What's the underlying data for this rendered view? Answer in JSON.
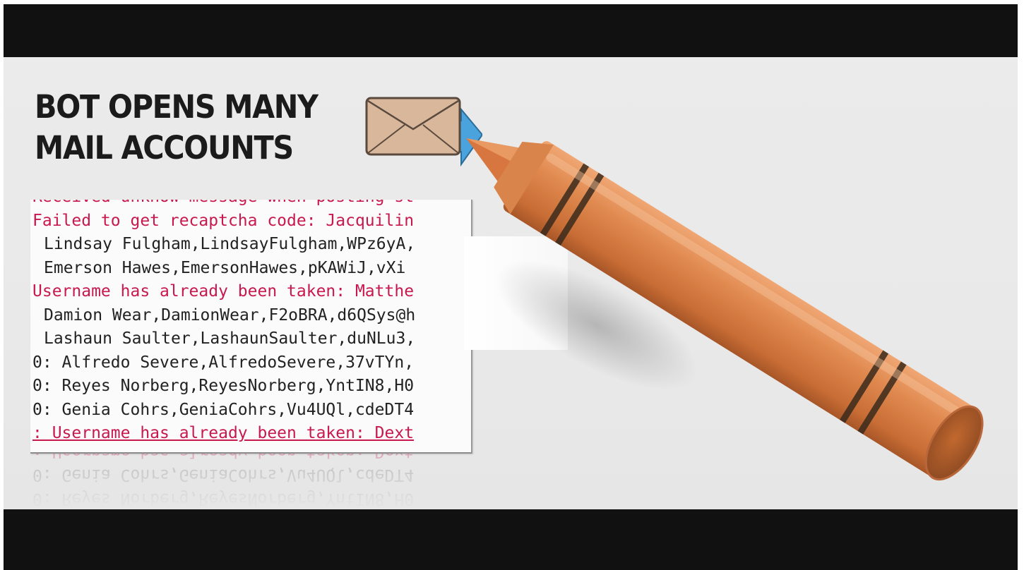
{
  "headline": {
    "line1": "BOT OPENS MANY",
    "line2": "MAIL ACCOUNTS"
  },
  "console": {
    "lines": [
      {
        "text": "Received unknow message when posting st",
        "type": "err",
        "indent": false
      },
      {
        "text": "Failed to get recaptcha code: Jacquilin",
        "type": "err",
        "indent": false
      },
      {
        "text": "Lindsay Fulgham,LindsayFulgham,WPz6yA,",
        "type": "normal",
        "indent": true
      },
      {
        "text": "Emerson Hawes,EmersonHawes,pKAWiJ,vXi",
        "type": "normal",
        "indent": true
      },
      {
        "text": "Username has already been taken: Matthe",
        "type": "err",
        "indent": false
      },
      {
        "text": "Damion Wear,DamionWear,F2oBRA,d6QSys@h",
        "type": "normal",
        "indent": true
      },
      {
        "text": "Lashaun Saulter,LashaunSaulter,duNLu3,",
        "type": "normal",
        "indent": true
      },
      {
        "text": "0: Alfredo Severe,AlfredoSevere,37vTYn,",
        "type": "normal",
        "indent": false
      },
      {
        "text": "0: Reyes Norberg,ReyesNorberg,YntIN8,H0",
        "type": "normal",
        "indent": false
      },
      {
        "text": "0: Genia Cohrs,GeniaCohrs,Vu4UQl,cdeDT4",
        "type": "normal",
        "indent": false
      },
      {
        "text": ": Username has already been taken: Dext",
        "type": "err",
        "indent": false
      }
    ],
    "colors": {
      "error": "#c8194f",
      "normal": "#222222"
    }
  },
  "reflection": {
    "lines": [
      {
        "text": ": Username has already been taken: Dext",
        "type": "err"
      },
      {
        "text": "0: Genia Cohrs,GeniaCohrs,Vu4UQl,cdeDT4",
        "type": "normal"
      },
      {
        "text": "0: Reyes Norberg,ReyesNorberg,YntIN8,H0",
        "type": "normal"
      }
    ]
  },
  "illustrations": {
    "envelope": "envelope-with-arrow-icon",
    "crayon": "orange-crayon"
  },
  "colors": {
    "letterbox": "#111111",
    "background": "#eaeaea",
    "crayon": "#d9834a",
    "arrow": "#4aa3dd",
    "envelope": "#d9b79a"
  }
}
